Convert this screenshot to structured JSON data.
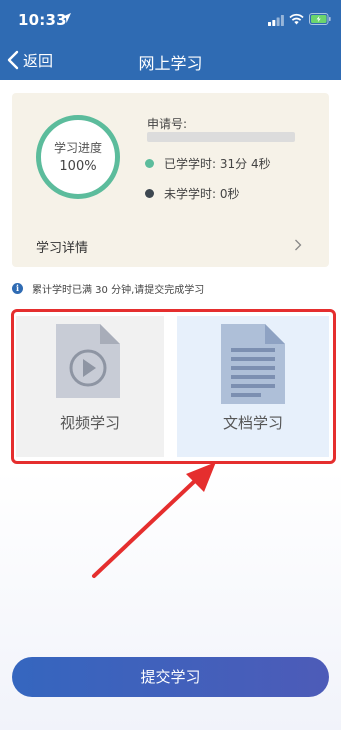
{
  "status_bar": {
    "time": "10:33"
  },
  "nav": {
    "back_label": "返回",
    "title": "网上学习"
  },
  "progress": {
    "ring_title": "学习进度",
    "ring_value": "100%",
    "percent": 100,
    "application_no_label": "申请号:",
    "studied": "已学学时: 31分 4秒",
    "remaining": "未学学时: 0秒",
    "detail_link": "学习详情"
  },
  "notice": "累计学时已满 30 分钟,请提交完成学习",
  "courses": [
    {
      "label": "视频学习",
      "icon": "video-file-icon"
    },
    {
      "label": "文档学习",
      "icon": "document-icon"
    }
  ],
  "submit_label": "提交学习",
  "colors": {
    "header": "#2f6bb3",
    "progress_green": "#5cbc9c",
    "highlight_red": "#e52e2e",
    "submit_button": "#3d62bc"
  }
}
